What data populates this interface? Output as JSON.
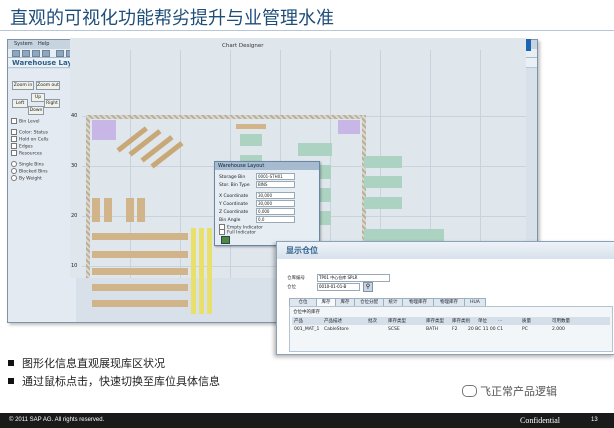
{
  "slide": {
    "title": "直观的可视化功能帮劣提升与业管理水准"
  },
  "sap_window": {
    "menu": [
      "System",
      "Help"
    ],
    "title": "Warehouse Layout",
    "brand": "SAP",
    "left_panel": {
      "buttons": [
        "Zoom in",
        "Zoom out",
        "Up",
        "Left",
        "Right",
        "Down"
      ],
      "checkboxes": [
        "Bin Level",
        "Color: Status",
        "Hold on Cells",
        "Edges",
        "Resources"
      ],
      "radios": [
        "Single Bins",
        "Blocked Bins",
        "By Weight"
      ]
    },
    "canvas": {
      "chart_title": "Chart Designer",
      "y_ticks": [
        "40",
        "30",
        "20",
        "10"
      ]
    },
    "dialog": {
      "title": "Warehouse Layout",
      "fields": [
        {
          "label": "Storage Bin",
          "value": "0001-STH01"
        },
        {
          "label": "Stor. Bin Type",
          "value": "BINS"
        },
        {
          "label": "X Coordinate",
          "value": "30,000"
        },
        {
          "label": "Y Coordinate",
          "value": "30,000"
        },
        {
          "label": "Z Coordinate",
          "value": "0,000"
        },
        {
          "label": "Bin Angle",
          "value": "0,0"
        }
      ],
      "checks": [
        "Empty Indicator",
        "Full Indicator"
      ]
    }
  },
  "stock_window": {
    "title": "显示仓位",
    "fields": [
      {
        "label": "仓库编号",
        "value": "TP01 中心仓库 SPLR"
      },
      {
        "label": "仓位",
        "value": "0010-01-01-B"
      }
    ],
    "tabs": [
      "仓位",
      "库存",
      "库存",
      "仓位分配",
      "统计",
      "物理库存",
      "物理库存",
      "HUA"
    ],
    "section_label": "仓位中的库存",
    "columns": [
      "产品",
      "产品描述",
      "批次",
      "库存类型",
      "库存类型",
      "库存类别",
      "单位",
      "...",
      "质量",
      "可用数量"
    ],
    "row": [
      "001_MAT_1",
      "CableStore",
      "",
      "SCSE",
      "BATH",
      "F2",
      "20 BC 11 00 C1",
      "PC",
      "",
      "2.000"
    ]
  },
  "bullets": [
    "图形化信息直观展现库区状况",
    "通过鼠标点击，快速切换至库位具体信息"
  ],
  "watermark": "飞正常产品逻辑",
  "footer": {
    "copyright": "© 2011 SAP AG. All rights reserved.",
    "classification": "Confidential",
    "page": "13"
  }
}
